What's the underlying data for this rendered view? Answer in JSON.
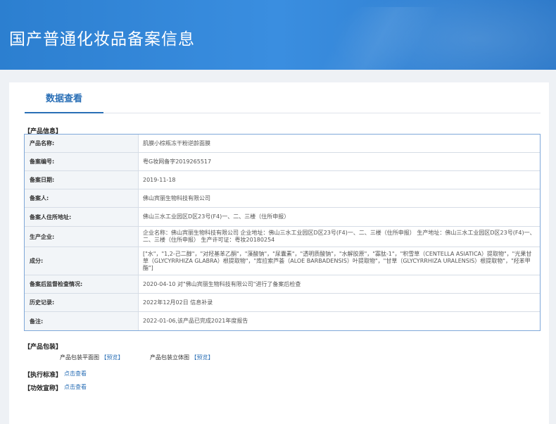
{
  "header": {
    "title": "国产普通化妆品备案信息"
  },
  "tabs": [
    {
      "label": "数据查看"
    }
  ],
  "product_info": {
    "section_label": "【产品信息】",
    "rows": [
      {
        "label": "产品名称:",
        "value": "肌膜小棕瓶冻干粉逆龄面膜"
      },
      {
        "label": "备案编号:",
        "value": "粤G妆网备字2019265517"
      },
      {
        "label": "备案日期:",
        "value": "2019-11-18"
      },
      {
        "label": "备案人:",
        "value": "佛山宾丽生物科技有限公司"
      },
      {
        "label": "备案人住所地址:",
        "value": "佛山三水工业园区D区23号(F4)一、二、三楼（住所申报）"
      },
      {
        "label": "生产企业:",
        "value": "企业名称：佛山宾丽生物科技有限公司 企业地址：佛山三水工业园区D区23号(F4)一、二、三楼（住所申报） 生产地址：佛山三水工业园区D区23号(F4)一、二、三楼（住所申报） 生产许可证：粤妆20180254"
      },
      {
        "label": "成分:",
        "value": "[\"水\"，\"1,2-己二醇\"，\"对羟基苯乙酮\"，\"藻酸钠\"，\"尿囊素\"，\"透明质酸钠\"，\"水解胶原\"，\"寡肽-1\"，\"积雪草（CENTELLA ASIATICA）提取物\"，\"光果甘草（GLYCYRRHIZA GLABRA）根提取物\"，\"库拉索芦荟（ALOE BARBADENSIS）叶提取物\"，\"甘草（GLYCYRRHIZA URALENSIS）根提取物\"，\"羟苯甲酯\"]"
      },
      {
        "label": "备案后监督检查情况:",
        "value": "2020-04-10 对\"佛山宾丽生物科技有限公司\"进行了备案后检查"
      },
      {
        "label": "历史记录:",
        "value": "2022年12月02日 信息补录"
      },
      {
        "label": "备注:",
        "value": "2022-01-06,该产品已完成2021年度报告"
      }
    ]
  },
  "packaging": {
    "section_label": "【产品包装】",
    "flat_label": "产品包装平面图",
    "flat_link": "【预览】",
    "stereo_label": "产品包装立体图",
    "stereo_link": "【预览】"
  },
  "standard": {
    "label": "【执行标准】",
    "link": "点击查看"
  },
  "efficacy": {
    "label": "【功效宣称】",
    "link": "点击查看"
  }
}
